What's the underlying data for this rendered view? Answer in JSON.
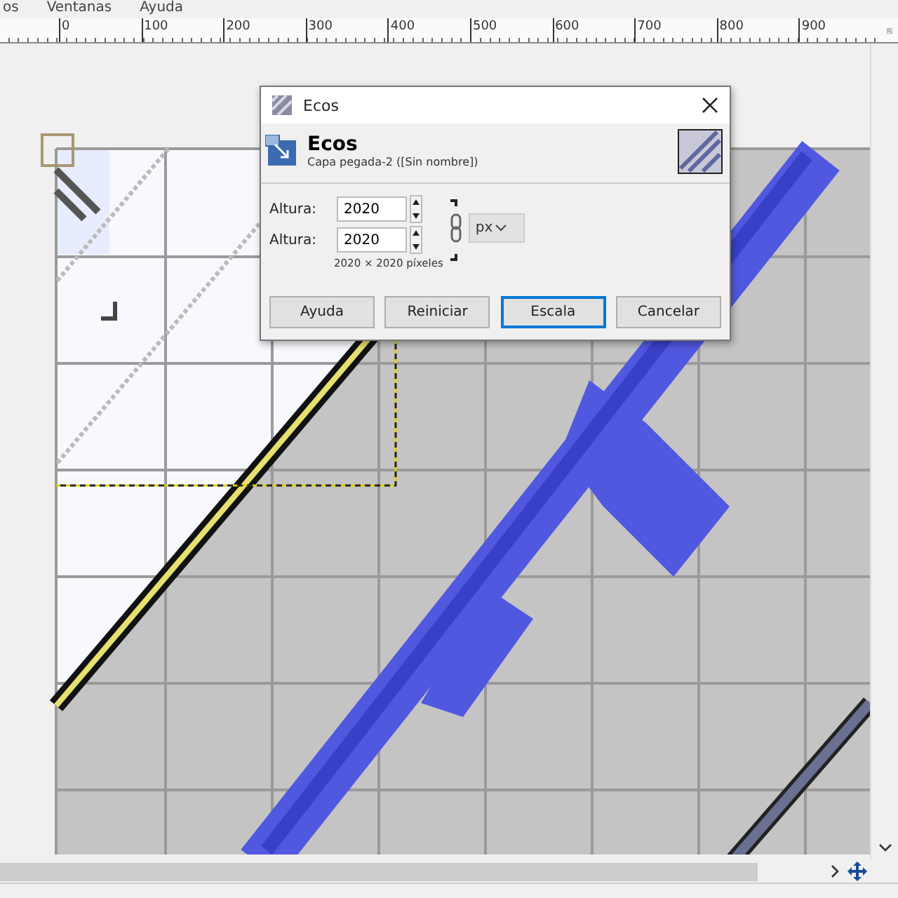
{
  "menu_bar": [
    {
      "label": "os"
    },
    {
      "label": "Ventanas"
    },
    {
      "label": "Ayuda"
    }
  ],
  "ruler": {
    "labels": [
      "0",
      "100",
      "200",
      "300",
      "400",
      "500",
      "600",
      "700",
      "800",
      "900"
    ]
  },
  "dialog": {
    "title": "Ecos",
    "header": {
      "title": "Ecos",
      "subtitle": "Capa pegada-2 ([Sin nombre])"
    },
    "fields": [
      {
        "label": "Altura:",
        "value": "2020"
      },
      {
        "label": "Altura:",
        "value": "2020"
      }
    ],
    "chain_linked": true,
    "unit": "px",
    "size_text": "2020 × 2020 píxeles",
    "buttons": [
      {
        "label": "Ayuda",
        "selected": false
      },
      {
        "label": "Reiniciar",
        "selected": false
      },
      {
        "label": "Escala",
        "selected": true
      },
      {
        "label": "Cancelar",
        "selected": false
      }
    ]
  }
}
